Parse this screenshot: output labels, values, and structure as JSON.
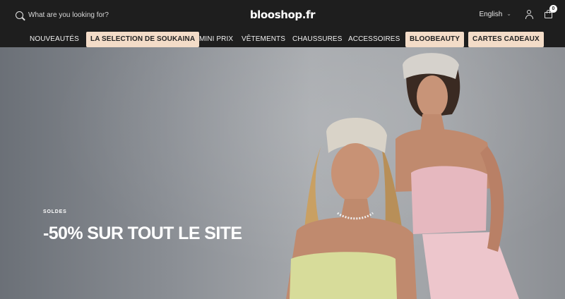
{
  "header": {
    "search_placeholder": "What are you looking for?",
    "logo": "blooshop.fr",
    "language": "English",
    "cart_count": "0"
  },
  "nav": {
    "items": [
      {
        "label": "NOUVEAUTÉS",
        "highlight": false
      },
      {
        "label": "LA SELECTION DE SOUKAINA",
        "highlight": true
      },
      {
        "label": "MINI PRIX",
        "highlight": false
      },
      {
        "label": "VÊTEMENTS",
        "highlight": false
      },
      {
        "label": "CHAUSSURES",
        "highlight": false
      },
      {
        "label": "ACCESSOIRES",
        "highlight": false
      },
      {
        "label": "BLOOBEAUTY",
        "highlight": true
      },
      {
        "label": "CARTES CADEAUX",
        "highlight": true
      }
    ]
  },
  "hero": {
    "eyebrow": "SOLDES",
    "title": "-50% SUR TOUT LE SITE"
  },
  "colors": {
    "header_bg": "#1e1e1e",
    "highlight_pill": "#f3dcc8",
    "hero_text": "#ffffff"
  },
  "icons": {
    "search": "search-icon",
    "language_chevron": "chevron-down-icon",
    "account": "user-icon",
    "cart": "shopping-bag-icon"
  }
}
